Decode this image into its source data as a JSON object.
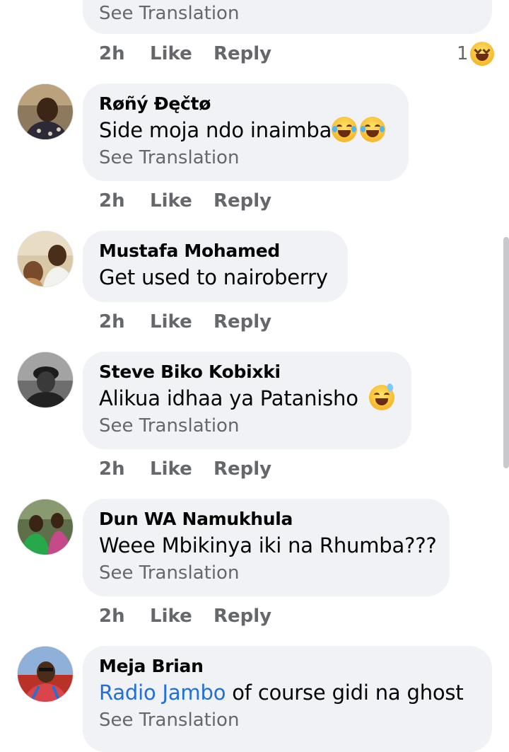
{
  "top_comment": {
    "see_translation": "See Translation",
    "time": "2h",
    "like_label": "Like",
    "reply_label": "Reply",
    "reaction_count": "1",
    "reaction_icon": "laughing-emoji-icon"
  },
  "comments": [
    {
      "author": "Røñý Ðęčtø",
      "text": "Side moja ndo inaimba",
      "emoji": [
        "tears-of-joy-emoji-icon",
        "tears-of-joy-emoji-icon"
      ],
      "see_translation": "See Translation",
      "time": "2h",
      "like_label": "Like",
      "reply_label": "Reply"
    },
    {
      "author": "Mustafa Mohamed",
      "text": "Get used to nairoberry",
      "time": "2h",
      "like_label": "Like",
      "reply_label": "Reply"
    },
    {
      "author": "Steve Biko Kobixki",
      "text": "Alikua idhaa ya Patanisho ",
      "emoji": [
        "grinning-sweat-emoji-icon"
      ],
      "see_translation": "See Translation",
      "time": "2h",
      "like_label": "Like",
      "reply_label": "Reply"
    },
    {
      "author": "Dun WA Namukhula",
      "text": "Weee Mbikinya iki na Rhumba???",
      "see_translation": "See Translation",
      "time": "2h",
      "like_label": "Like",
      "reply_label": "Reply"
    },
    {
      "author": "Meja Brian",
      "mention": "Radio Jambo",
      "text": " of course gidi na ghost",
      "see_translation": "See Translation"
    }
  ],
  "colors": {
    "bubble": "#f0f2f5",
    "meta": "#65676b",
    "mention": "#216fdb"
  }
}
